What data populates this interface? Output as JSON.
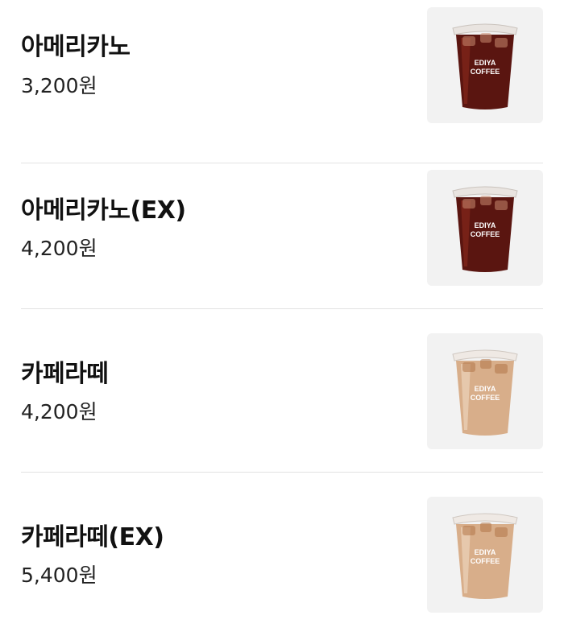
{
  "menu": {
    "items": [
      {
        "name": "아메리카노",
        "price": "3,200원",
        "image": {
          "icon": "iced-americano-cup-icon",
          "cup_label_line1": "EDIYA",
          "cup_label_line2": "COFFEE",
          "drink_color": "#5a1510",
          "drink_color_light": "#8a2a1c"
        }
      },
      {
        "name": "아메리카노(EX)",
        "price": "4,200원",
        "image": {
          "icon": "iced-americano-cup-icon",
          "cup_label_line1": "EDIYA",
          "cup_label_line2": "COFFEE",
          "drink_color": "#5a1510",
          "drink_color_light": "#8a2a1c"
        }
      },
      {
        "name": "카페라떼",
        "price": "4,200원",
        "image": {
          "icon": "iced-cafe-latte-cup-icon",
          "cup_label_line1": "EDIYA",
          "cup_label_line2": "COFFEE",
          "drink_color": "#d8ae8a",
          "drink_color_light": "#ecd3bb"
        }
      },
      {
        "name": "카페라떼(EX)",
        "price": "5,400원",
        "image": {
          "icon": "iced-cafe-latte-cup-icon",
          "cup_label_line1": "EDIYA",
          "cup_label_line2": "COFFEE",
          "drink_color": "#d8ae8a",
          "drink_color_light": "#ecd3bb"
        }
      }
    ]
  }
}
